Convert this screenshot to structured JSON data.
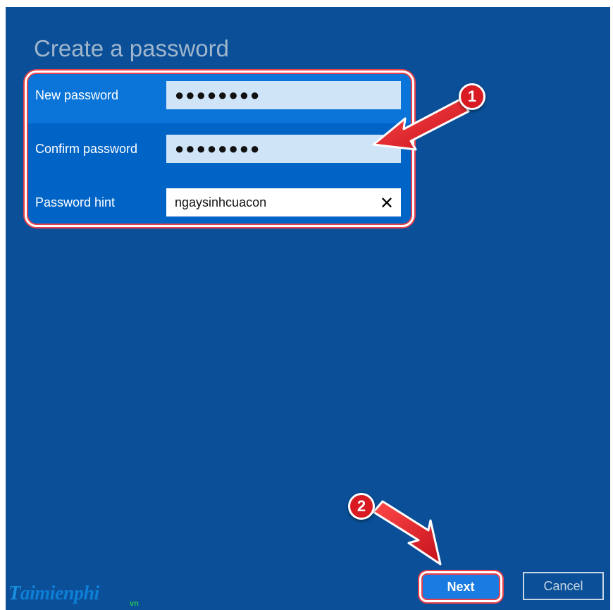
{
  "dialog": {
    "title": "Create a password"
  },
  "form": {
    "new_password": {
      "label": "New password",
      "value": "●●●●●●●●"
    },
    "confirm_password": {
      "label": "Confirm password",
      "value": "●●●●●●●●"
    },
    "password_hint": {
      "label": "Password hint",
      "value": "ngaysinhcuacon",
      "clear_icon": "✕"
    }
  },
  "buttons": {
    "next": "Next",
    "cancel": "Cancel"
  },
  "annotations": {
    "step1": "1",
    "step2": "2"
  },
  "watermark": {
    "brand": "aimienphi",
    "brand_initial": "T",
    "suffix": "vn"
  },
  "colors": {
    "window_bg": "#0a4f97",
    "highlight": "#e8404a",
    "badge": "#d91a23"
  }
}
